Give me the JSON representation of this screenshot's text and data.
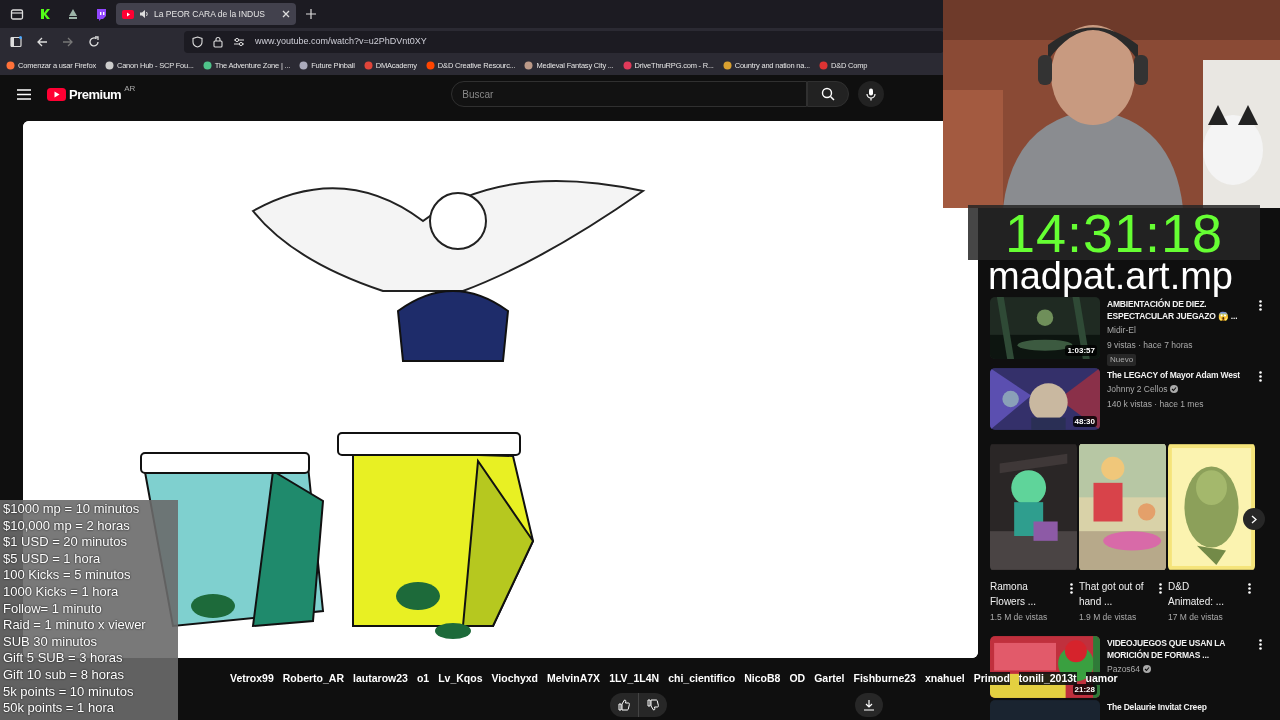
{
  "browser": {
    "tabs": [
      {
        "kind": "pinned",
        "selected": false
      },
      {
        "kind": "pinned",
        "selected": false
      },
      {
        "kind": "pinned",
        "selected": false
      },
      {
        "kind": "page",
        "title": "La PEOR CARA de la INDUS",
        "selected": true
      }
    ],
    "address": "www.youtube.com/watch?v=u2PhDVnt0XY",
    "bookmarks": [
      "Comenzar a usar Firefox",
      "Canon Hub - SCP Fou...",
      "The Adventure Zone | ...",
      "Future Pinball",
      "DMAcademy",
      "D&D Creative Resourc...",
      "Medieval Fantasy City ...",
      "DriveThruRPG.com - R...",
      "Country and nation na...",
      "D&D Comp"
    ]
  },
  "youtube": {
    "logo": "Premium",
    "region": "AR",
    "search": {
      "placeholder": "Buscar"
    }
  },
  "recommendations": [
    {
      "kind": "video",
      "title": "AMBIENTACIÓN DE DIEZ. ESPECTACULAR JUEGAZO 😱 ...",
      "channel": "Midir-El",
      "verified": false,
      "meta": "9 vistas · hace 7 horas",
      "badge": "Nuevo",
      "duration": "1:03:57"
    },
    {
      "kind": "video",
      "title": "The LEGACY of Mayor Adam West",
      "channel": "Johnny 2 Cellos",
      "verified": true,
      "meta": "140 k vistas · hace 1 mes",
      "duration": "48:30"
    },
    {
      "kind": "shorts",
      "items": [
        {
          "title": "Ramona Flowers ...",
          "views": "1.5 M de vistas"
        },
        {
          "title": "That got out of hand ...",
          "views": "1.9 M de vistas"
        },
        {
          "title": "D&D Animated: ...",
          "views": "17 M de vistas"
        }
      ]
    },
    {
      "kind": "video",
      "title": "VIDEOJUEGOS QUE USAN LA MORICIÓN DE FORMAS ...",
      "channel": "Pazos64",
      "verified": true,
      "duration": "21:28"
    },
    {
      "kind": "video",
      "title": "The Delaurie Invitat Creep"
    }
  ],
  "overlay": {
    "timer": "14:31:18",
    "handle": "madpat.art.mp",
    "rates": [
      "$1000 mp = 10 minutos",
      "$10,000 mp = 2 horas",
      "$1 USD = 20 minutos",
      "$5 USD = 1 hora",
      "100 Kicks = 5 minutos",
      "1000 Kicks = 1 hora",
      "Follow= 1 minuto",
      "Raid = 1 minuto x viewer",
      "SUB 30 minutos",
      "Gift 5 SUB = 3 horas",
      "Gift 10 sub = 8 horas",
      "5k points = 10 minutos",
      "50k points = 1 hora"
    ],
    "ticker": [
      "Vetrox99",
      "Roberto_AR",
      "lautarow23",
      "o1",
      "Lv_Kqos",
      "Viochyxd",
      "MelvinA7X",
      "1LV_1L4N",
      "chi_cientifico",
      "NicoB8",
      "OD",
      "Gartel",
      "Fishburne23",
      "xnahuel",
      "Primod",
      "tonili_2013t",
      "uamor"
    ]
  }
}
